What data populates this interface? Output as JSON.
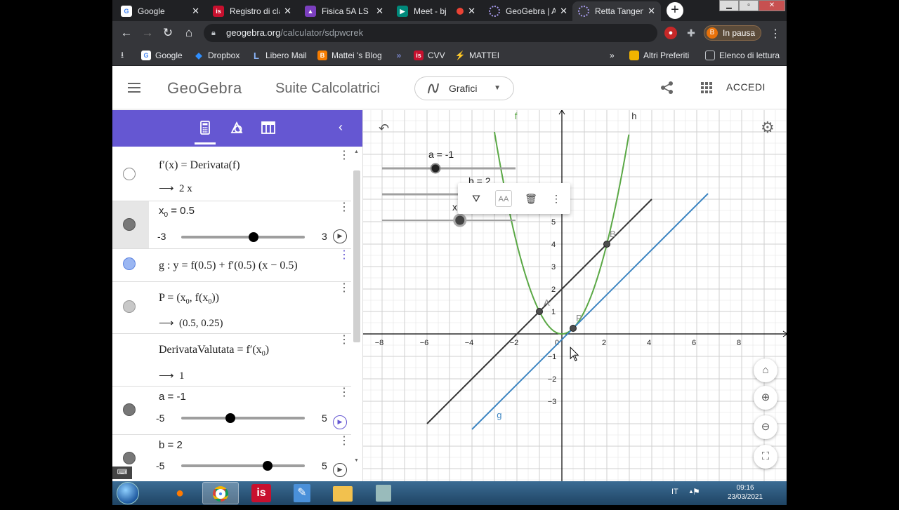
{
  "browser": {
    "tabs": [
      {
        "title": "Google",
        "favicon": "google-icon",
        "color": "#4285f4",
        "active": false
      },
      {
        "title": "Registro di cla",
        "favicon": "is-icon",
        "color": "#c8102e",
        "active": false
      },
      {
        "title": "Fisica 5A LS",
        "favicon": "classroom-icon",
        "color": "#7b3fbf",
        "active": false
      },
      {
        "title": "Meet - bj",
        "favicon": "meet-icon",
        "color": "#00897b",
        "active": false
      },
      {
        "title": "GeoGebra | A",
        "favicon": "geogebra-icon",
        "color": "#6557d2",
        "active": false
      },
      {
        "title": "Retta Tangen",
        "favicon": "geogebra-icon",
        "color": "#6557d2",
        "active": true
      }
    ],
    "new_tab_label": "+",
    "url_host": "geogebra.org",
    "url_path": "/calculator/sdpwcrek",
    "profile_label": "In pausa",
    "profile_initial": "B",
    "bookmarks": [
      {
        "label": "Google",
        "icon": "google-icon",
        "color": "#4285f4"
      },
      {
        "label": "Dropbox",
        "icon": "dropbox-icon",
        "color": "#0061ff"
      },
      {
        "label": "Libero Mail",
        "icon": "libero-icon",
        "color": "#1e88e5"
      },
      {
        "label": "Mattei 's Blog",
        "icon": "blogger-icon",
        "color": "#f57c00"
      },
      {
        "label": "",
        "icon": "arrows-icon",
        "color": "#5c6bc0"
      },
      {
        "label": "CVV",
        "icon": "is-icon",
        "color": "#c8102e"
      },
      {
        "label": "MATTEI",
        "icon": "mattei-icon",
        "color": "#8bc34a"
      }
    ],
    "bookmarks_overflow": "»",
    "other_bookmarks": "Altri Preferiti",
    "reading_list": "Elenco di lettura"
  },
  "app": {
    "logo": "GeoGebra",
    "suite_title": "Suite Calcolatrici",
    "app_selector": "Grafici",
    "login": "ACCEDI"
  },
  "algebra": {
    "rows": [
      {
        "expr": "f′(x) = Derivata(f)",
        "output": "2 x",
        "dot": "empty"
      },
      {
        "name": "x",
        "sub": "0",
        "value": "= 0.5",
        "min": "-3",
        "max": "3",
        "slider_fraction": 0.583,
        "dot": "dark"
      },
      {
        "expr": "g : y = f(0.5) + f′(0.5) (x − 0.5)",
        "dot": "blue"
      },
      {
        "expr_before": "P = (x",
        "expr_mid": ", f(x",
        "expr_after": "))",
        "output": "(0.5, 0.25)",
        "dot": "lgrey"
      },
      {
        "expr_before": "DerivataValutata = f′(x",
        "expr_after": ")",
        "output": "1",
        "dot": "none"
      },
      {
        "name": "a",
        "value": "= -1",
        "min": "-5",
        "max": "5",
        "slider_fraction": 0.4,
        "dot": "dark"
      },
      {
        "name": "b",
        "value": "= 2",
        "min": "-5",
        "max": "5",
        "slider_fraction": 0.7,
        "dot": "dark"
      }
    ]
  },
  "graphics": {
    "x_ticks": [
      "−8",
      "−6",
      "−4",
      "−2",
      "0",
      "2",
      "4",
      "6",
      "8"
    ],
    "y_ticks_pos": [
      "1",
      "2",
      "3",
      "4",
      "5"
    ],
    "y_ticks_neg": [
      "−1",
      "−2",
      "−3"
    ],
    "curve_labels": {
      "f": "f",
      "g": "g",
      "h": "h"
    },
    "point_labels": {
      "A": "A",
      "B": "B",
      "P": "P"
    },
    "points": {
      "A": [
        -1,
        1
      ],
      "B": [
        2,
        4
      ],
      "P": [
        0.5,
        0.25
      ]
    },
    "sliders": [
      {
        "label": "a = -1",
        "fraction": 0.4
      },
      {
        "label": "b = 2",
        "fraction": 0.7
      },
      {
        "label": "x",
        "fraction": 0.583
      }
    ],
    "colors": {
      "f": "#5aa845",
      "g": "#3e86c2",
      "h": "#333333",
      "point": "#4d4d4d",
      "grid": "#e4e4e4",
      "axis": "#000000"
    }
  },
  "taskbar": {
    "language": "IT",
    "time": "09:16",
    "date": "23/03/2021"
  }
}
